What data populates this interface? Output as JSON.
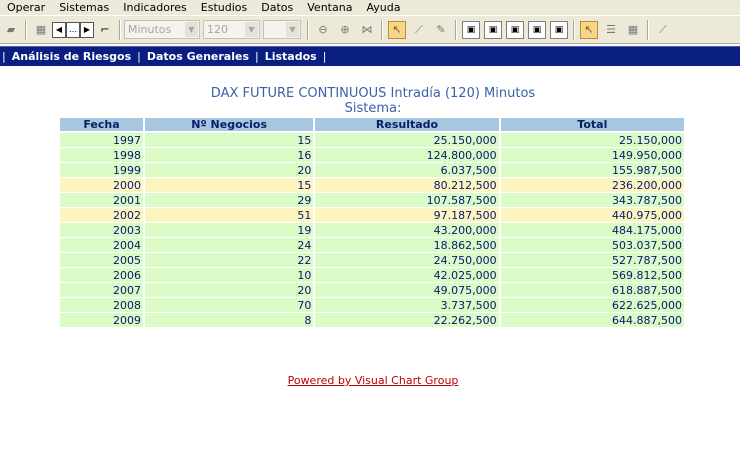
{
  "menu": [
    "Operar",
    "Sistemas",
    "Indicadores",
    "Estudios",
    "Datos",
    "Ventana",
    "Ayuda"
  ],
  "toolbar": {
    "period_value": "Minutos",
    "interval_value": "120",
    "empty_combo_value": ""
  },
  "nav": {
    "items": [
      "Análisis de Riesgos",
      "Datos Generales",
      "Listados"
    ]
  },
  "report": {
    "title": "DAX FUTURE CONTINUOUS Intradía (120) Minutos",
    "subtitle": "Sistema:",
    "columns": [
      "Fecha",
      "Nº Negocios",
      "Resultado",
      "Total"
    ],
    "rows": [
      {
        "fecha": "1997",
        "negocios": "15",
        "resultado": "25.150,000",
        "total": "25.150,000",
        "highlight": false
      },
      {
        "fecha": "1998",
        "negocios": "16",
        "resultado": "124.800,000",
        "total": "149.950,000",
        "highlight": false
      },
      {
        "fecha": "1999",
        "negocios": "20",
        "resultado": "6.037,500",
        "total": "155.987,500",
        "highlight": false
      },
      {
        "fecha": "2000",
        "negocios": "15",
        "resultado": "80.212,500",
        "total": "236.200,000",
        "highlight": true
      },
      {
        "fecha": "2001",
        "negocios": "29",
        "resultado": "107.587,500",
        "total": "343.787,500",
        "highlight": false
      },
      {
        "fecha": "2002",
        "negocios": "51",
        "resultado": "97.187,500",
        "total": "440.975,000",
        "highlight": true
      },
      {
        "fecha": "2003",
        "negocios": "19",
        "resultado": "43.200,000",
        "total": "484.175,000",
        "highlight": false
      },
      {
        "fecha": "2004",
        "negocios": "24",
        "resultado": "18.862,500",
        "total": "503.037,500",
        "highlight": false
      },
      {
        "fecha": "2005",
        "negocios": "22",
        "resultado": "24.750,000",
        "total": "527.787,500",
        "highlight": false
      },
      {
        "fecha": "2006",
        "negocios": "10",
        "resultado": "42.025,000",
        "total": "569.812,500",
        "highlight": false
      },
      {
        "fecha": "2007",
        "negocios": "20",
        "resultado": "49.075,000",
        "total": "618.887,500",
        "highlight": false
      },
      {
        "fecha": "2008",
        "negocios": "70",
        "resultado": "3.737,500",
        "total": "622.625,000",
        "highlight": false
      },
      {
        "fecha": "2009",
        "negocios": "8",
        "resultado": "22.262,500",
        "total": "644.887,500",
        "highlight": false
      }
    ]
  },
  "footer": {
    "link": "Powered by Visual Chart Group"
  },
  "colors": {
    "nav_band": "#0a1e82",
    "header_cell": "#a7c6e0",
    "row_green": "#dafac6",
    "row_yellow": "#fdf5c1",
    "title_text": "#3a62a7",
    "footer_link": "#c00000"
  }
}
